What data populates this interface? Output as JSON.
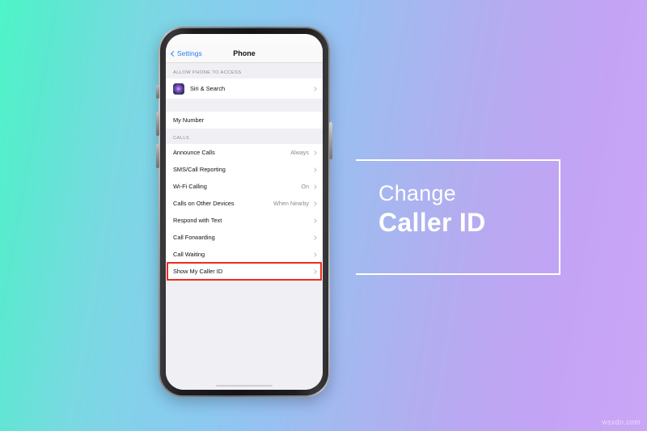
{
  "background": {
    "gradient_from": "#4ef5c8",
    "gradient_mid": "#8cc9f0",
    "gradient_to": "#cba6f7"
  },
  "phone": {
    "statusbar": {
      "time": "",
      "right": ""
    },
    "navbar": {
      "back_label": "Settings",
      "title": "Phone"
    },
    "sections": [
      {
        "header": "ALLOW PHONE TO ACCESS",
        "rows": [
          {
            "label": "Siri & Search",
            "value": "",
            "icon": "siri-icon",
            "chevron": true,
            "highlighted": false
          }
        ]
      },
      {
        "header": "",
        "rows": [
          {
            "label": "My Number",
            "value": "",
            "icon": "",
            "chevron": false,
            "highlighted": false
          }
        ]
      },
      {
        "header": "CALLS",
        "rows": [
          {
            "label": "Announce Calls",
            "value": "Always",
            "icon": "",
            "chevron": true,
            "highlighted": false
          },
          {
            "label": "SMS/Call Reporting",
            "value": "",
            "icon": "",
            "chevron": true,
            "highlighted": false
          },
          {
            "label": "Wi-Fi Calling",
            "value": "On",
            "icon": "",
            "chevron": true,
            "highlighted": false
          },
          {
            "label": "Calls on Other Devices",
            "value": "When Nearby",
            "icon": "",
            "chevron": true,
            "highlighted": false
          },
          {
            "label": "Respond with Text",
            "value": "",
            "icon": "",
            "chevron": true,
            "highlighted": false
          },
          {
            "label": "Call Forwarding",
            "value": "",
            "icon": "",
            "chevron": true,
            "highlighted": false
          },
          {
            "label": "Call Waiting",
            "value": "",
            "icon": "",
            "chevron": true,
            "highlighted": false
          },
          {
            "label": "Show My Caller ID",
            "value": "",
            "icon": "",
            "chevron": true,
            "highlighted": true
          }
        ]
      }
    ],
    "highlight_color": "#ef2b1f"
  },
  "callout": {
    "line1": "Change",
    "line2": "Caller ID",
    "text_color": "#ffffff",
    "frame_color": "#ffffff"
  },
  "watermark": {
    "text": "wsxdn.com"
  }
}
